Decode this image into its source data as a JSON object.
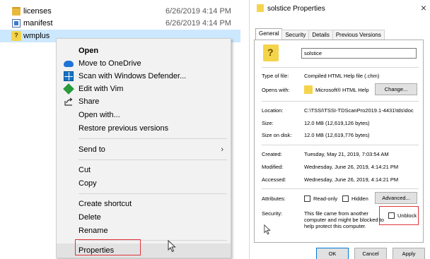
{
  "explorer": {
    "files": [
      {
        "name": "licenses",
        "date": "6/26/2019 4:14 PM",
        "icon": "folder-icon"
      },
      {
        "name": "manifest",
        "date": "6/26/2019 4:14 PM",
        "icon": "document-icon"
      },
      {
        "name": "wmplus",
        "date": "",
        "icon": "chm-file-icon"
      }
    ]
  },
  "context_menu": {
    "items": {
      "open": "Open",
      "onedrive": "Move to OneDrive",
      "defender": "Scan with Windows Defender...",
      "vim": "Edit with Vim",
      "share": "Share",
      "open_with": "Open with...",
      "restore": "Restore previous versions",
      "send_to": "Send to",
      "cut": "Cut",
      "copy": "Copy",
      "create_shortcut": "Create shortcut",
      "delete": "Delete",
      "rename": "Rename",
      "properties": "Properties"
    },
    "submenu_arrow": "›"
  },
  "dialog": {
    "title": "solstice Properties",
    "close": "×",
    "tabs": [
      "General",
      "Security",
      "Details",
      "Previous Versions"
    ],
    "file_name": "solstice",
    "type_label": "Type of file:",
    "type_value": "Compiled HTML Help file (.chm)",
    "opens_label": "Opens with:",
    "opens_value": "Microsoft® HTML Help",
    "change_button": "Change...",
    "location_label": "Location:",
    "location_value": "C:\\TSSI\\TSSI-TDScanPro2019.1-4431\\tds\\doc",
    "size_label": "Size:",
    "size_value": "12.0 MB (12,619,126 bytes)",
    "size_disk_label": "Size on disk:",
    "size_disk_value": "12.0 MB (12,619,776 bytes)",
    "created_label": "Created:",
    "created_value": "Tuesday, May 21, 2019, 7:03:54 AM",
    "modified_label": "Modified:",
    "modified_value": "Wednesday, June 26, 2019, 4:14:21 PM",
    "accessed_label": "Accessed:",
    "accessed_value": "Wednesday, June 26, 2019, 4:14:21 PM",
    "attributes_label": "Attributes:",
    "readonly_label": "Read-only",
    "hidden_label": "Hidden",
    "advanced_button": "Advanced...",
    "security_label": "Security:",
    "security_text_1": "This file came from another",
    "security_text_2": "computer and might be blocked to",
    "security_text_3": "help protect this computer.",
    "unblock_label": "Unblock",
    "ok_button": "OK",
    "cancel_button": "Cancel",
    "apply_button": "Apply"
  },
  "colors": {
    "highlight_red": "#e0353b",
    "selection_blue": "#cce8ff",
    "menu_bg": "#f2f2f2"
  }
}
